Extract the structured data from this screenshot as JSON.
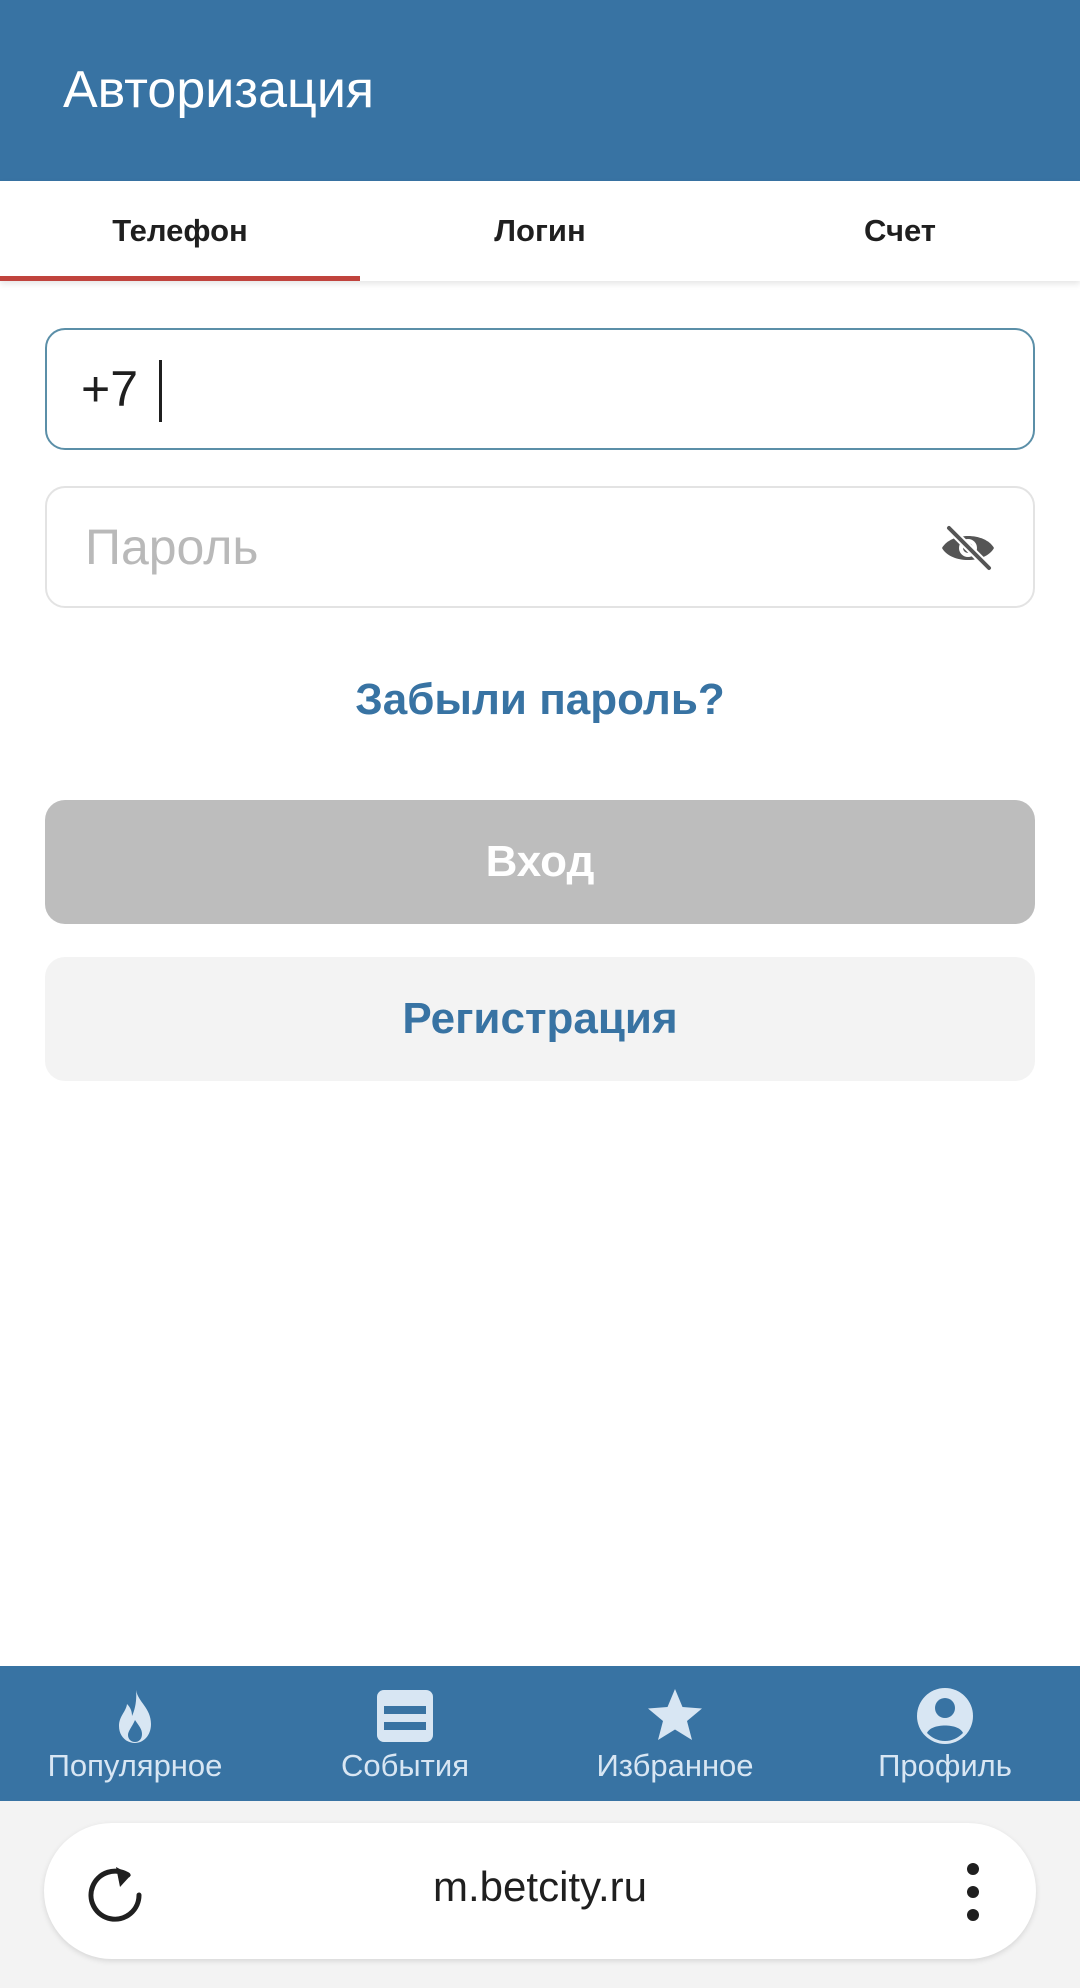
{
  "header": {
    "title": "Авторизация"
  },
  "tabs": [
    {
      "label": "Телефон",
      "active": true
    },
    {
      "label": "Логин",
      "active": false
    },
    {
      "label": "Счет",
      "active": false
    }
  ],
  "form": {
    "phone_value": "+7",
    "password_placeholder": "Пароль",
    "password_toggle_icon": "eye-off-icon",
    "forgot_label": "Забыли пароль?",
    "login_label": "Вход",
    "register_label": "Регистрация"
  },
  "bottom_nav": [
    {
      "label": "Популярное",
      "icon": "flame-icon"
    },
    {
      "label": "События",
      "icon": "events-card-icon"
    },
    {
      "label": "Избранное",
      "icon": "star-icon"
    },
    {
      "label": "Профиль",
      "icon": "profile-icon"
    }
  ],
  "browser": {
    "url": "m.betcity.ru",
    "reload_icon": "reload-icon",
    "menu_icon": "more-vert-icon"
  },
  "colors": {
    "primary": "#3873a3",
    "active_tab_underline": "#c0433d",
    "disabled_button": "#bdbdbd",
    "secondary_button": "#f3f3f3"
  }
}
